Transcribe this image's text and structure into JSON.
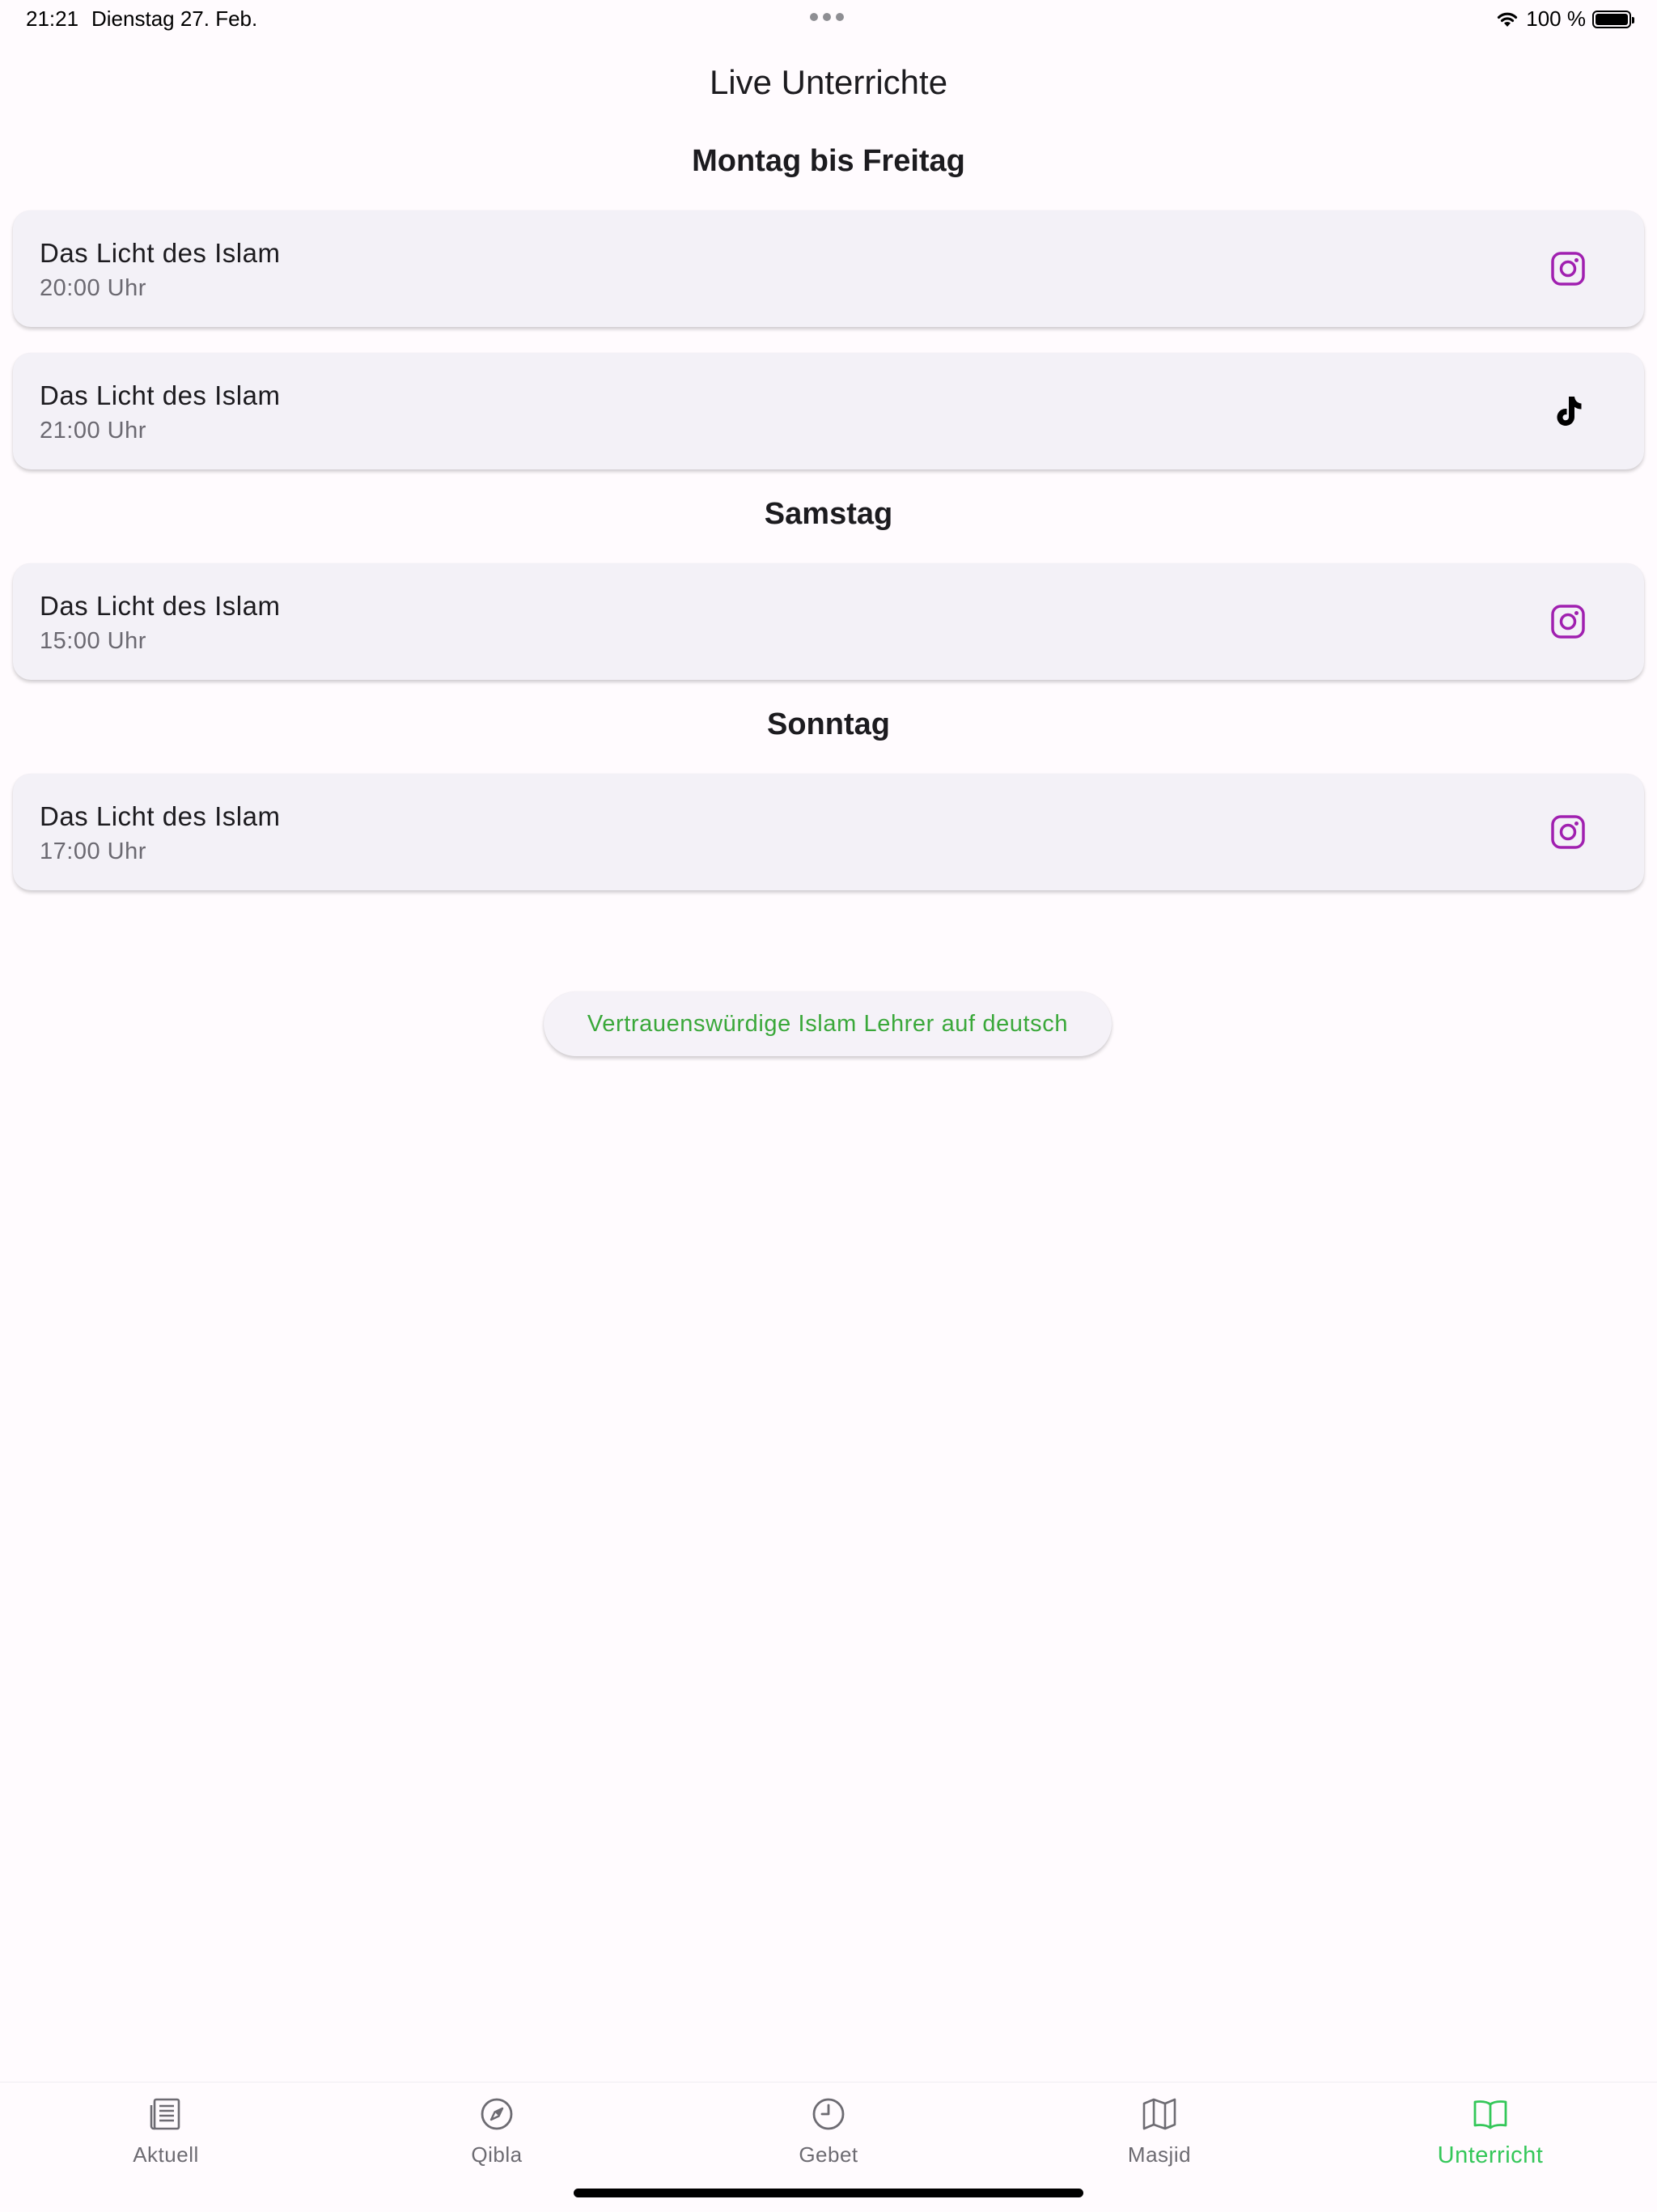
{
  "status_bar": {
    "time": "21:21",
    "date": "Dienstag 27. Feb.",
    "battery": "100 %"
  },
  "page": {
    "title": "Live Unterrichte"
  },
  "sections": [
    {
      "heading": "Montag bis Freitag",
      "items": [
        {
          "title": "Das Licht des Islam",
          "time": "20:00 Uhr",
          "platform": "instagram-icon"
        },
        {
          "title": "Das Licht des Islam",
          "time": "21:00 Uhr",
          "platform": "tiktok-icon"
        }
      ]
    },
    {
      "heading": "Samstag",
      "items": [
        {
          "title": "Das Licht des Islam",
          "time": "15:00 Uhr",
          "platform": "instagram-icon"
        }
      ]
    },
    {
      "heading": "Sonntag",
      "items": [
        {
          "title": "Das Licht des Islam",
          "time": "17:00 Uhr",
          "platform": "instagram-icon"
        }
      ]
    }
  ],
  "teachers_button": {
    "label": "Vertrauenswürdige Islam Lehrer auf deutsch"
  },
  "bottom_nav": {
    "items": [
      {
        "label": "Aktuell",
        "icon": "newspaper-icon"
      },
      {
        "label": "Qibla",
        "icon": "compass-icon"
      },
      {
        "label": "Gebet",
        "icon": "clock-icon"
      },
      {
        "label": "Masjid",
        "icon": "map-icon"
      },
      {
        "label": "Unterricht",
        "icon": "book-icon",
        "active": true
      }
    ]
  },
  "colors": {
    "background": "#fffbfe",
    "card": "#f3f1f7",
    "instagram": "#a020b0",
    "accent_green": "#34c759",
    "button_text_green": "#3aa83a",
    "nav_inactive": "#6d6b72"
  }
}
